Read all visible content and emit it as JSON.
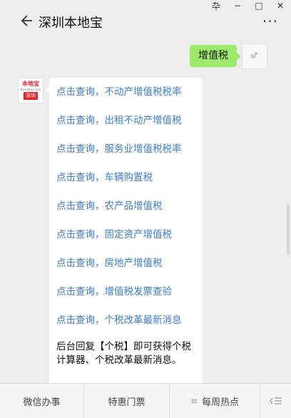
{
  "window": {
    "controls": [
      "卆",
      "−",
      "□",
      "✕"
    ]
  },
  "header": {
    "title": "深圳本地宝",
    "more_label": "···"
  },
  "user_message": {
    "text": "增值税"
  },
  "bot_avatar": {
    "top": "本地宝",
    "middle": "Bendibao.com",
    "bottom": "深圳"
  },
  "bot_message": {
    "links": [
      "点击查询，不动产增值税税率",
      "点击查询，出租不动产增值税",
      "点击查询，服务业增值税税率",
      "点击查询，车辆购置税",
      "点击查询，农产品增值税",
      "点击查询，固定资产增值税",
      "点击查询，房地产增值税",
      "点击查询，增值税发票查验",
      "点击查询，个税改革最新消息"
    ],
    "note": "后台回复【个税】即可获得个税计算器、个税改革最新消息。"
  },
  "bottom_menu": {
    "items": [
      "微信办事",
      "特惠门票",
      "每周热点"
    ],
    "menu_icon": "≡",
    "switch_icon": "keyboard-switch-icon"
  }
}
